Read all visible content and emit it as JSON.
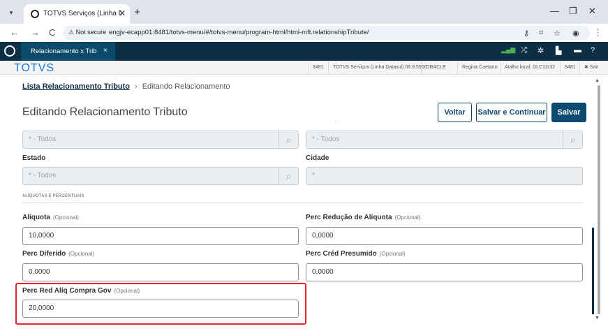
{
  "browser": {
    "tab_title": "TOTVS Serviços (Linha Datasul)",
    "tab_close": "✕",
    "new_tab": "+",
    "window_controls": [
      "—",
      "❐",
      "✕"
    ],
    "nav": {
      "back": "←",
      "forward": "→",
      "reload": "C"
    },
    "security_label": "⚠ Not secure",
    "url": "engjv-ecapp01:8481/totvs-menu/#/totvs-menu/program-html/html-mft.relationshipTribute/"
  },
  "app": {
    "tab_label": "Relacionamento x Trib",
    "tab_close": "×",
    "toolbar_icons": [
      "signal-icon",
      "shuffle-icon",
      "gear-icon",
      "document-icon",
      "chat-icon",
      "help-icon"
    ],
    "brand": "TOTVS",
    "info": [
      "8481",
      "TOTVS Serviços (Linha Datasul) 06.9.5500",
      "ORACLE",
      "Regina Caetano",
      "Atalho local: DLC12r32",
      "8481",
      "✖ Sair"
    ]
  },
  "breadcrumb": {
    "link": "Lista Relacionamento Tributo",
    "sep": "›",
    "current": "Editando Relacionamento"
  },
  "page_title": "Editando Relacionamento Tributo",
  "buttons": {
    "back": "Voltar",
    "save_continue": "Salvar e Continuar",
    "save": "Salvar"
  },
  "filters": {
    "top_left_value": "* - Todos",
    "top_right_value": "* - Todos",
    "estado_label": "Estado",
    "estado_value": "* - Todos",
    "cidade_label": "Cidade",
    "cidade_value": "*"
  },
  "section_title": "ALÍQUOTAS E PERCENTUAIS",
  "optional_tag": "(Opcional)",
  "fields": {
    "aliquota_label": "Alíquota",
    "aliquota_value": "10,0000",
    "perc_reducao_label": "Perc Redução de Alíquota",
    "perc_reducao_value": "0,0000",
    "perc_diferido_label": "Perc Diferido",
    "perc_diferido_value": "0,0000",
    "perc_cred_label": "Perc Créd Presumido",
    "perc_cred_value": "0,0000",
    "perc_red_gov_label": "Perc Red Alíq Compra Gov",
    "perc_red_gov_value": "20,0000"
  },
  "colors": {
    "topbar": "#0c2f45",
    "primary": "#0c4a72",
    "highlight": "#e0262c"
  }
}
